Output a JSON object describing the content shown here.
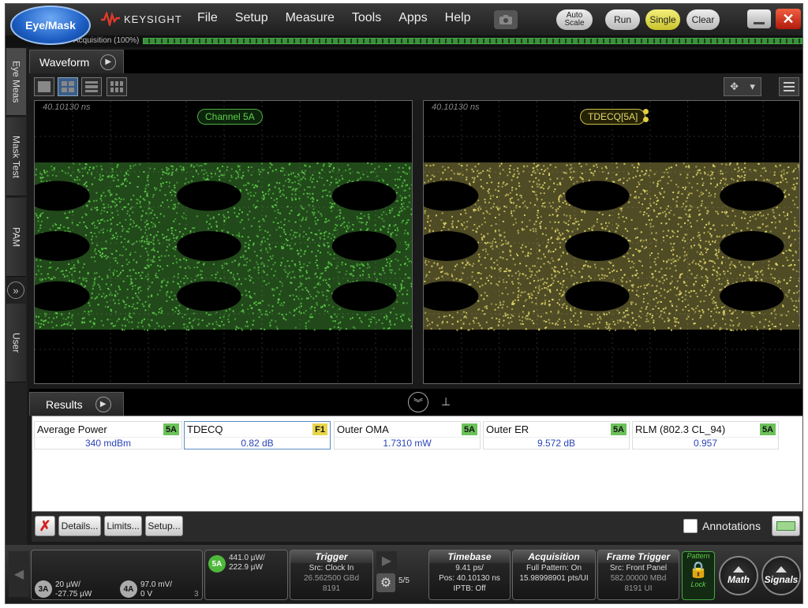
{
  "menubar": {
    "eye_mask_button": "Eye/Mask",
    "brand": "KEYSIGHT",
    "menu_items": [
      "File",
      "Setup",
      "Measure",
      "Tools",
      "Apps",
      "Help"
    ],
    "auto_scale": "Auto\nScale",
    "run": "Run",
    "single": "Single",
    "clear": "Clear"
  },
  "acquisition": {
    "label": "Acquisition  (100%)"
  },
  "left_tabs": {
    "eye_meas": "Eye Meas",
    "mask_test": "Mask Test",
    "pam": "PAM",
    "user": "User"
  },
  "waveform": {
    "tab_label": "Waveform",
    "left_pane": {
      "time": "40.10130 ns",
      "label": "Channel 5A",
      "color": "#5fd04a"
    },
    "right_pane": {
      "time": "40.10130 ns",
      "label": "TDECQ[5A]",
      "color": "#e2d86a"
    }
  },
  "results": {
    "tab_label": "Results",
    "items": [
      {
        "name": "Average Power",
        "badge": "5A",
        "badge_color": "#6cc25a",
        "value": "340 mdBm"
      },
      {
        "name": "TDECQ",
        "badge": "F1",
        "badge_color": "#e8d64a",
        "value": "0.82 dB"
      },
      {
        "name": "Outer OMA",
        "badge": "5A",
        "badge_color": "#6cc25a",
        "value": "1.7310 mW"
      },
      {
        "name": "Outer ER",
        "badge": "5A",
        "badge_color": "#6cc25a",
        "value": "9.572 dB"
      },
      {
        "name": "RLM (802.3 CL_94)",
        "badge": "5A",
        "badge_color": "#6cc25a",
        "value": "0.957"
      }
    ],
    "footer": {
      "details": "Details...",
      "limits": "Limits...",
      "setup": "Setup...",
      "annotations": "Annotations"
    }
  },
  "statusbar": {
    "ch3a": {
      "label": "3A",
      "line1": "20 µW/",
      "line2": "-27.75 µW"
    },
    "ch4a": {
      "label": "4A",
      "line1": "97.0 mV/",
      "line2": "0 V"
    },
    "left_box_number": "3",
    "ch5a": {
      "label": "5A",
      "line1": "441.0 µW/",
      "line2": "222.9 µW"
    },
    "trigger": {
      "title": "Trigger",
      "line1": "Src: Clock In",
      "line2": "26.562500 GBd",
      "line3": "8191",
      "number": "5"
    },
    "page": "5/5",
    "timebase": {
      "title": "Timebase",
      "line1": "9.41 ps/",
      "line2": "Pos: 40.10130 ns",
      "line3": "IPTB: Off"
    },
    "acquisition": {
      "title": "Acquisition",
      "line1": "Full Pattern: On",
      "line2": "15.98998901 pts/UI"
    },
    "frame_trigger": {
      "title": "Frame Trigger",
      "line1": "Src: Front Panel",
      "line2": "582.00000 MBd",
      "line3": "8191 UI"
    },
    "pattern_lock": {
      "top": "Pattern",
      "bottom": "Lock"
    },
    "math": "Math",
    "signals": "Signals"
  }
}
